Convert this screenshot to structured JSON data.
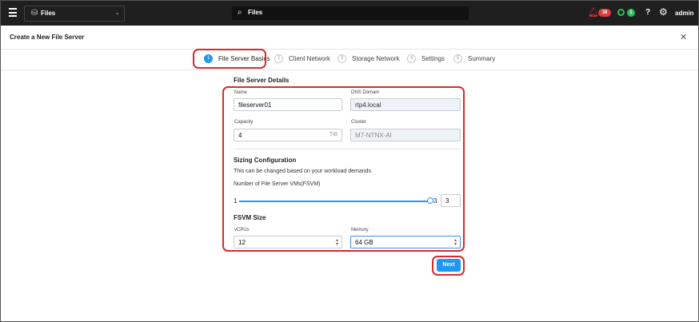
{
  "topnav": {
    "app_selector": "Files",
    "search_text": "Files",
    "alerts_count": "38",
    "tasks_count": "1",
    "help": "?",
    "user": "admin"
  },
  "modal": {
    "title": "Create a New File Server"
  },
  "steps": [
    {
      "num": "1",
      "label": "File Server Basics"
    },
    {
      "num": "2",
      "label": "Client Network"
    },
    {
      "num": "3",
      "label": "Storage Network"
    },
    {
      "num": "4",
      "label": "Settings"
    },
    {
      "num": "5",
      "label": "Summary"
    }
  ],
  "details": {
    "section_title": "File Server Details",
    "name_label": "Name",
    "name_value": "fileserver01",
    "dns_label": "DNS Domain",
    "dns_value": "rtp4.local",
    "capacity_label": "Capacity",
    "capacity_value": "4",
    "capacity_unit": "TiB",
    "cluster_label": "Cluster",
    "cluster_value": "M7-NTNX-AI"
  },
  "sizing": {
    "section_title": "Sizing Configuration",
    "hint": "This can be changed based on your workload demands",
    "fsvm_label": "Number of File Server VMs(FSVM)",
    "slider_min": "1",
    "slider_max": "3",
    "slider_value": 3,
    "fsvm_value": "3"
  },
  "fsvm_size": {
    "section_title": "FSVM Size",
    "vcpu_label": "vCPUs",
    "vcpu_value": "12",
    "memory_label": "Memory",
    "memory_value": "64 GB"
  },
  "actions": {
    "next_label": "Next"
  },
  "colors": {
    "accent": "#2196f3",
    "highlight": "#d92b2b",
    "nav_bg": "#1f1f1f",
    "alert": "#e23b3b",
    "success": "#2ebd59"
  }
}
